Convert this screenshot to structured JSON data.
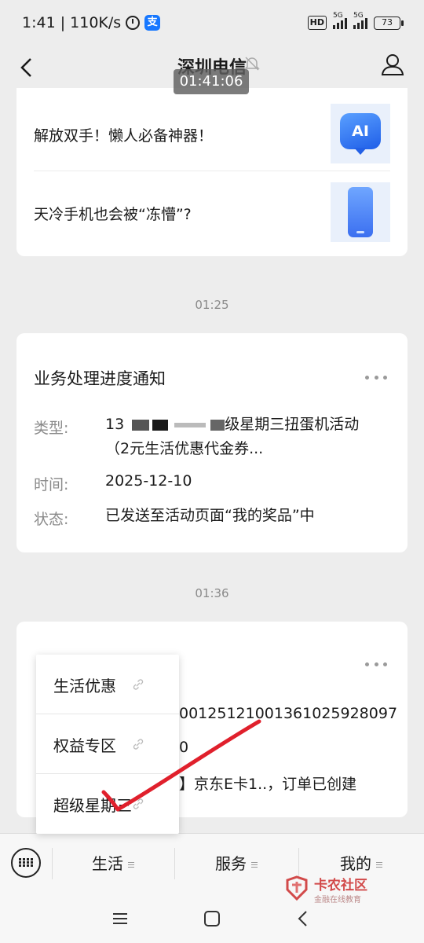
{
  "status_bar": {
    "time_speed": "1:41 | 110K/s",
    "alipay_glyph": "支",
    "hd": "HD",
    "network_a": "5G",
    "network_b": "5G",
    "battery": "73"
  },
  "header": {
    "title": "深圳电信",
    "time_overlay": "01:41:06"
  },
  "articles": [
    {
      "title": "解放双手！懒人必备神器！",
      "thumb_text": "AI"
    },
    {
      "title": "天冷手机也会被“冻懵”?"
    }
  ],
  "timestamps": [
    "01:25",
    "01:36"
  ],
  "notice": {
    "title": "业务处理进度通知",
    "rows": [
      {
        "label": "类型:",
        "value_start": "13",
        "value_mid": "级星期三扭蛋机活动",
        "value_line2": "（2元生活优惠代金券..."
      },
      {
        "label": "时间:",
        "value": "2025-12-10"
      },
      {
        "label": "状态:",
        "value": "已发送至活动页面“我的奖品”中"
      }
    ]
  },
  "notice2": {
    "line1": "0012512100136102592809​7",
    "line2": "0",
    "line3": "】京东E卡1..，订单已创建"
  },
  "popup_menu": {
    "items": [
      "生活优惠",
      "权益专区",
      "超级星期三"
    ]
  },
  "bottom_menu": {
    "tabs": [
      "生活",
      "服务",
      "我的"
    ]
  },
  "watermark": {
    "title": "卡农社区",
    "subtitle": "金融在线教育"
  }
}
